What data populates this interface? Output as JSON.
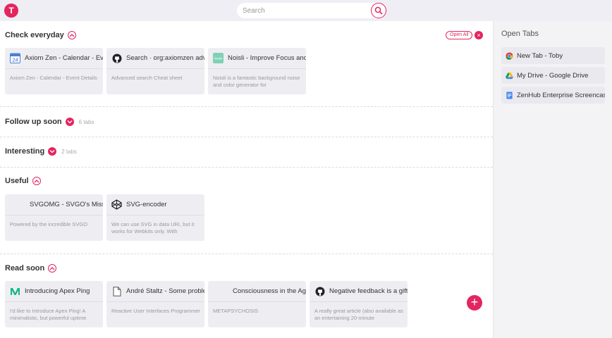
{
  "app": {
    "logo_letter": "T",
    "accent": "#e2265f"
  },
  "search": {
    "placeholder": "Search",
    "icon": "search-icon"
  },
  "sections": {
    "check_everyday": {
      "title": "Check everyday",
      "open_all_label": "Open All",
      "cards": [
        {
          "title": "Axiom Zen - Calendar - Event Details",
          "desc": "Axiom Zen - Calendar - Event Details",
          "icon": "calendar-icon",
          "icon_text": "24"
        },
        {
          "title": "Search · org:axiomzen advanced",
          "desc": "Advanced search Cheat sheet",
          "icon": "github-icon"
        },
        {
          "title": "Noisli - Improve Focus and Boost Productivity",
          "desc": "Noisli is a fantastic background noise and color generator for",
          "icon": "noisli-icon",
          "icon_text": "Noisli"
        }
      ]
    },
    "follow_up_soon": {
      "title": "Follow up soon",
      "count": "6 tabs"
    },
    "interesting": {
      "title": "Interesting",
      "count": "2 tabs"
    },
    "useful": {
      "title": "Useful",
      "cards": [
        {
          "title": "SVGOMG - SVGO's Missing GUI",
          "desc": "Powered by the incredible SVGO",
          "icon": "none"
        },
        {
          "title": "SVG-encoder",
          "desc": "We can use SVG in data URI, but it works for Webkits only. With",
          "icon": "codepen-icon"
        }
      ]
    },
    "read_soon": {
      "title": "Read soon",
      "cards": [
        {
          "title": "Introducing Apex Ping",
          "desc": "I'd like to Introduce Apex Ping! A minimalistic, but powerful uptime",
          "icon": "medium-icon"
        },
        {
          "title": "André Staltz - Some problems",
          "desc": "Reactive User Interfaces Programmer",
          "icon": "document-icon"
        },
        {
          "title": "Consciousness in the Age",
          "desc": "METAPSYCHOSIS",
          "icon": "none"
        },
        {
          "title": "Negative feedback is a gift",
          "desc": "A really great article (also available as an entertaining 20-minute",
          "icon": "github-icon"
        }
      ]
    }
  },
  "sidebar": {
    "title": "Open Tabs",
    "tabs": [
      {
        "label": "New Tab - Toby",
        "icon": "chrome-icon"
      },
      {
        "label": "My Drive - Google Drive",
        "icon": "google-drive-icon"
      },
      {
        "label": "ZenHub Enterprise Screencast",
        "icon": "google-docs-icon"
      }
    ]
  }
}
